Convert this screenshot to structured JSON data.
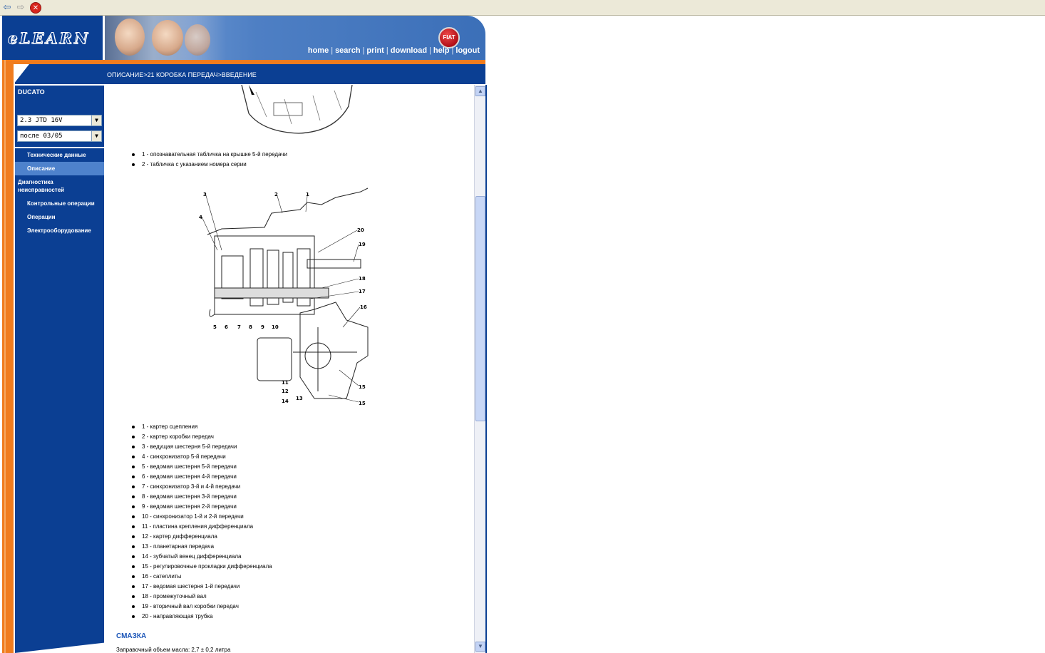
{
  "toolbar": {
    "back_icon": "back-arrow-icon",
    "forward_icon": "forward-arrow-icon",
    "stop_icon": "stop-icon"
  },
  "app": {
    "logo": "eLEARN",
    "brand_badge": "FIAT",
    "nav": {
      "home": "home",
      "search": "search",
      "print": "print",
      "download": "download",
      "help": "help",
      "logout": "logout"
    },
    "breadcrumb": "ОПИСАНИЕ>21 КОРОБКА ПЕРЕДАЧ>ВВЕДЕНИЕ"
  },
  "sidebar": {
    "model": "DUCATO",
    "engine_select": "2.3 JTD 16V",
    "date_select": "после 03/05",
    "items": [
      {
        "label": "Технические данные"
      },
      {
        "label": "Описание"
      },
      {
        "label": "Диагностика неисправностей"
      },
      {
        "label": "Контрольные операции"
      },
      {
        "label": "Операции"
      },
      {
        "label": "Электрооборудование"
      }
    ]
  },
  "content": {
    "plate_items": [
      "1 - опознавательная табличка на крышке 5-й передачи",
      "2 - табличка с указанием номера серии"
    ],
    "diagram_callouts": [
      "1",
      "2",
      "3",
      "4",
      "5",
      "6",
      "7",
      "8",
      "9",
      "10",
      "11",
      "12",
      "13",
      "14",
      "15",
      "15",
      "16",
      "17",
      "18",
      "19",
      "20"
    ],
    "legend_items": [
      "1 - картер сцепления",
      "2 - картер коробки передач",
      "3 - ведущая шестерня 5-й передачи",
      "4 - синхронизатор 5-й передачи",
      "5 - ведомая шестерня 5-й передачи",
      "6 - ведомая шестерня 4-й передачи",
      "7 - синхронизатор 3-й и 4-й передачи",
      "8 - ведомая шестерня 3-й передачи",
      "9 - ведомая шестерня 2-й передачи",
      "10 - синхронизатор 1-й и 2-й передачи",
      "11 - пластина крепления дифференциала",
      "12 - картер дифференциала",
      "13 - планетарная передача",
      "14 - зубчатый венец дифференциала",
      "15 - регулировочные прокладки дифференциала",
      "16 - сателлиты",
      "17 - ведомая шестерня 1-й передачи",
      "18 - промежуточный вал",
      "19 - вторичный вал коробки передач",
      "20 - направляющая трубка"
    ],
    "section_title": "СМАЗКА",
    "cut_line": "Заправочный объем масла: 2,7 ± 0,2 литра"
  },
  "colors": {
    "brand_blue": "#0b3f93",
    "accent_orange": "#f07c1e",
    "active_item": "#4e82cc",
    "section_title": "#1b55b8"
  }
}
